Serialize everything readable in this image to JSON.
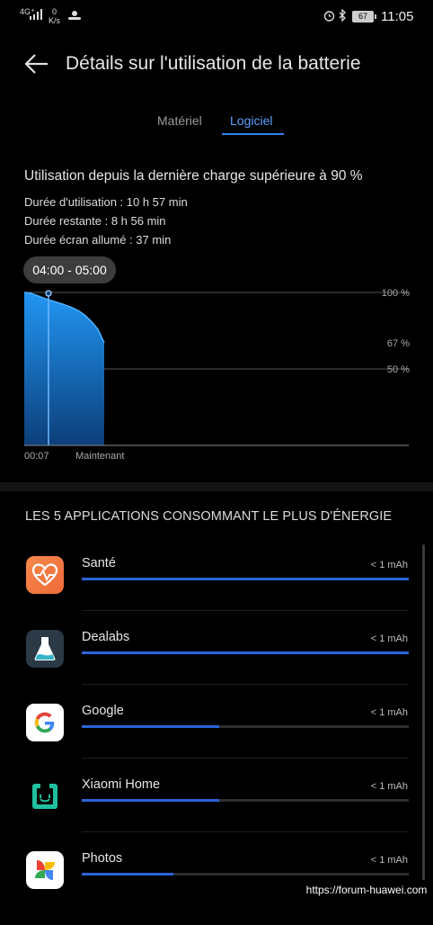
{
  "status_bar": {
    "network": "4G⁺",
    "speed_value": "0",
    "speed_unit": "K/s",
    "battery": "67",
    "time": "11:05"
  },
  "header": {
    "title": "Détails sur l'utilisation de la batterie"
  },
  "tabs": [
    {
      "label": "Matériel",
      "active": false
    },
    {
      "label": "Logiciel",
      "active": true
    }
  ],
  "usage": {
    "title": "Utilisation depuis la dernière charge supérieure à 90 %",
    "stats": [
      "Durée d'utilisation : 10 h 57 min",
      "Durée restante : 8 h 56 min",
      "Durée écran allumé : 37 min"
    ]
  },
  "chart_data": {
    "type": "area",
    "tooltip": "04:00 - 05:00",
    "x_labels": [
      "00:07",
      "Maintenant"
    ],
    "y_ticks": [
      {
        "label": "100 %",
        "value": 100
      },
      {
        "label": "67 %",
        "value": 67
      },
      {
        "label": "50 %",
        "value": 50
      }
    ],
    "ylim": [
      0,
      100
    ],
    "x": [
      0,
      0.08,
      0.16,
      0.26,
      0.38,
      0.5,
      0.6,
      0.68,
      0.76,
      0.84,
      0.92,
      1.0
    ],
    "values": [
      100,
      99.5,
      98,
      96,
      94,
      92,
      90,
      88,
      85,
      81,
      76,
      67
    ],
    "grid": true
  },
  "apps": {
    "header": "LES 5 APPLICATIONS CONSOMMANT LE PLUS D'ÉNERGIE",
    "items": [
      {
        "name": "Santé",
        "value": "< 1 mAh",
        "fill": 1.0,
        "icon": "heart-health-icon"
      },
      {
        "name": "Dealabs",
        "value": "< 1 mAh",
        "fill": 1.0,
        "icon": "dealabs-flask-icon"
      },
      {
        "name": "Google",
        "value": "< 1 mAh",
        "fill": 0.42,
        "icon": "google-g-icon"
      },
      {
        "name": "Xiaomi Home",
        "value": "< 1 mAh",
        "fill": 0.42,
        "icon": "xiaomi-home-icon"
      },
      {
        "name": "Photos",
        "value": "< 1 mAh",
        "fill": 0.28,
        "icon": "google-photos-pinwheel-icon"
      }
    ]
  },
  "watermark": "https://forum-huawei.com",
  "colors": {
    "accent": "#2f7ff0",
    "chart_fill": "#1e88e5",
    "bar": "#2a64d8"
  }
}
